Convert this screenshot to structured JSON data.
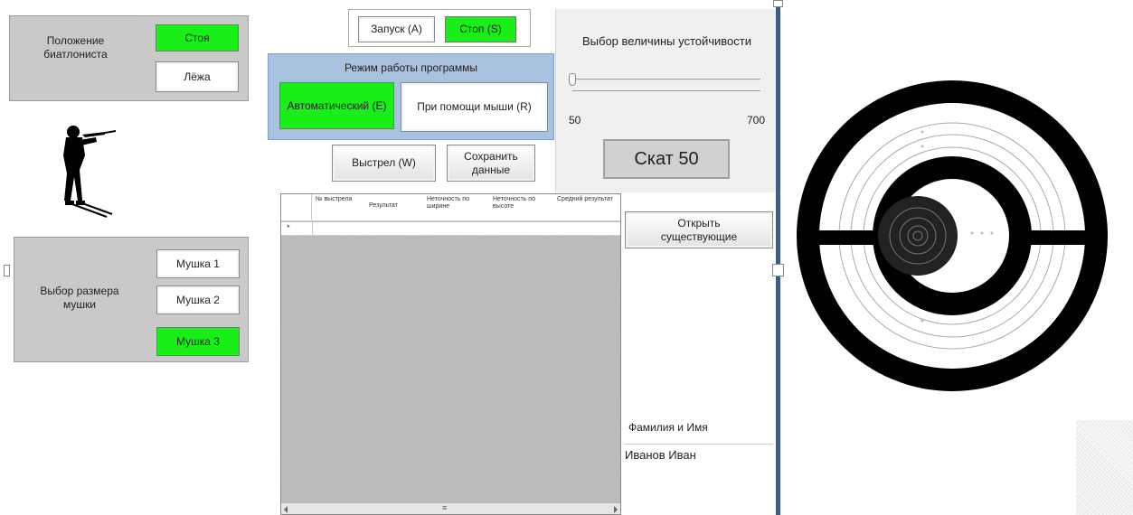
{
  "biathlete_position": {
    "label": "Положение биатлониста",
    "standing": "Стоя",
    "prone": "Лёжа"
  },
  "sight_size": {
    "label": "Выбор размера мушки",
    "options": [
      "Мушка 1",
      "Мушка 2",
      "Мушка 3"
    ],
    "selected_index": 2
  },
  "run_controls": {
    "start": "Запуск (A)",
    "stop": "Стоп (S)"
  },
  "mode": {
    "title": "Режим работы программы",
    "automatic": "Автоматический (E)",
    "mouse": "При помощи мыши (R)"
  },
  "actions": {
    "shot": "Выстрел (W)",
    "save": "Сохранить данные",
    "open": "Открыть существующие"
  },
  "stability": {
    "title": "Выбор величины устойчивости",
    "min": "50",
    "max": "700",
    "value_fraction": 0.0,
    "display": "Скат 50"
  },
  "table": {
    "columns": [
      "№ выстрела",
      "Результат",
      "Неточность по ширине",
      "Неточность по высоте",
      "Средний результат"
    ],
    "new_row_marker": "*",
    "scroll_marker": "≡"
  },
  "user": {
    "label": "Фамилия и Имя",
    "name": "Иванов Иван"
  },
  "colors": {
    "selected": "#19ee19",
    "mode_panel": "#a7c1df",
    "group_gray": "#c9c9c9",
    "target": "#000000"
  }
}
